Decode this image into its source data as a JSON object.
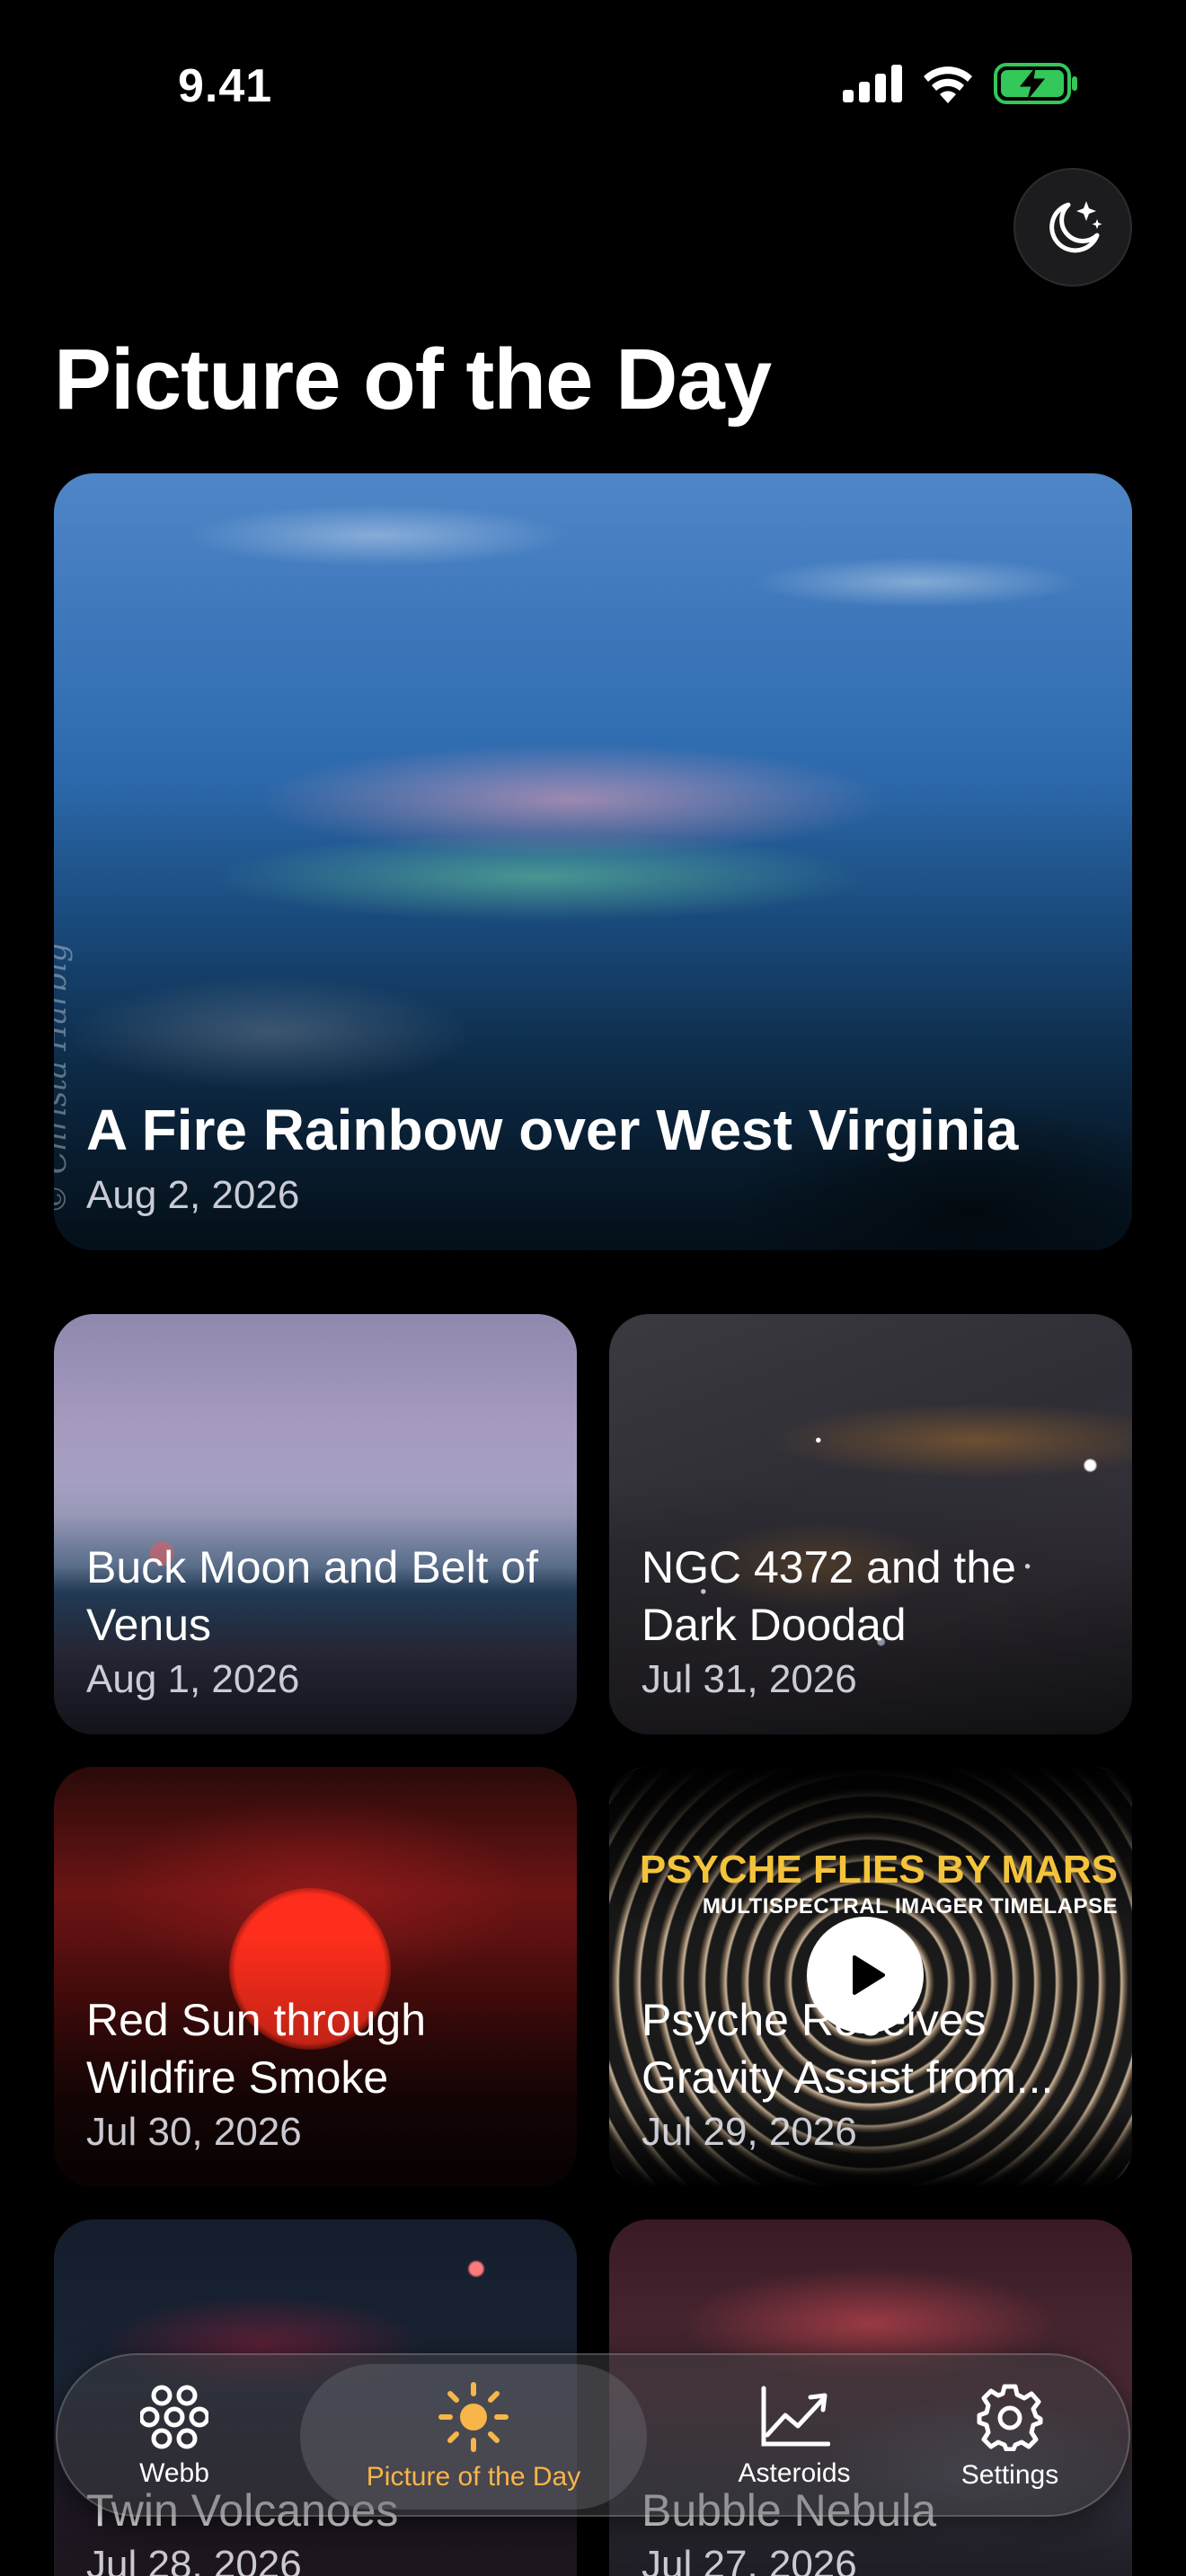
{
  "status": {
    "time": "9.41"
  },
  "page": {
    "title": "Picture of the Day"
  },
  "hero": {
    "title": "A Fire Rainbow over West Virginia",
    "date": "Aug 2, 2026",
    "credit": "© Christa Harbig"
  },
  "cards": [
    {
      "title": "Buck Moon and Belt of Venus",
      "date": "Aug 1, 2026"
    },
    {
      "title": "NGC 4372 and the Dark Doodad",
      "date": "Jul 31, 2026"
    },
    {
      "title": "Red Sun through Wildfire Smoke",
      "date": "Jul 30, 2026"
    },
    {
      "title": "Psyche Receives Gravity Assist from...",
      "date": "Jul 29, 2026",
      "video_heading": "PSYCHE FLIES BY MARS",
      "video_subheading": "MULTISPECTRAL IMAGER TIMELAPSE"
    },
    {
      "title": "Twin Volcanoes",
      "date": "Jul 28, 2026"
    },
    {
      "title": "Bubble Nebula",
      "date": "Jul 27, 2026"
    }
  ],
  "tabs": [
    {
      "label": "Webb",
      "icon": "hexagon-cluster-icon"
    },
    {
      "label": "Picture of the Day",
      "icon": "sun-icon",
      "active": true
    },
    {
      "label": "Asteroids",
      "icon": "chart-line-icon"
    },
    {
      "label": "Settings",
      "icon": "gear-icon"
    }
  ],
  "colors": {
    "accent": "#f7b54a",
    "battery": "#34c759",
    "background": "#000000"
  }
}
